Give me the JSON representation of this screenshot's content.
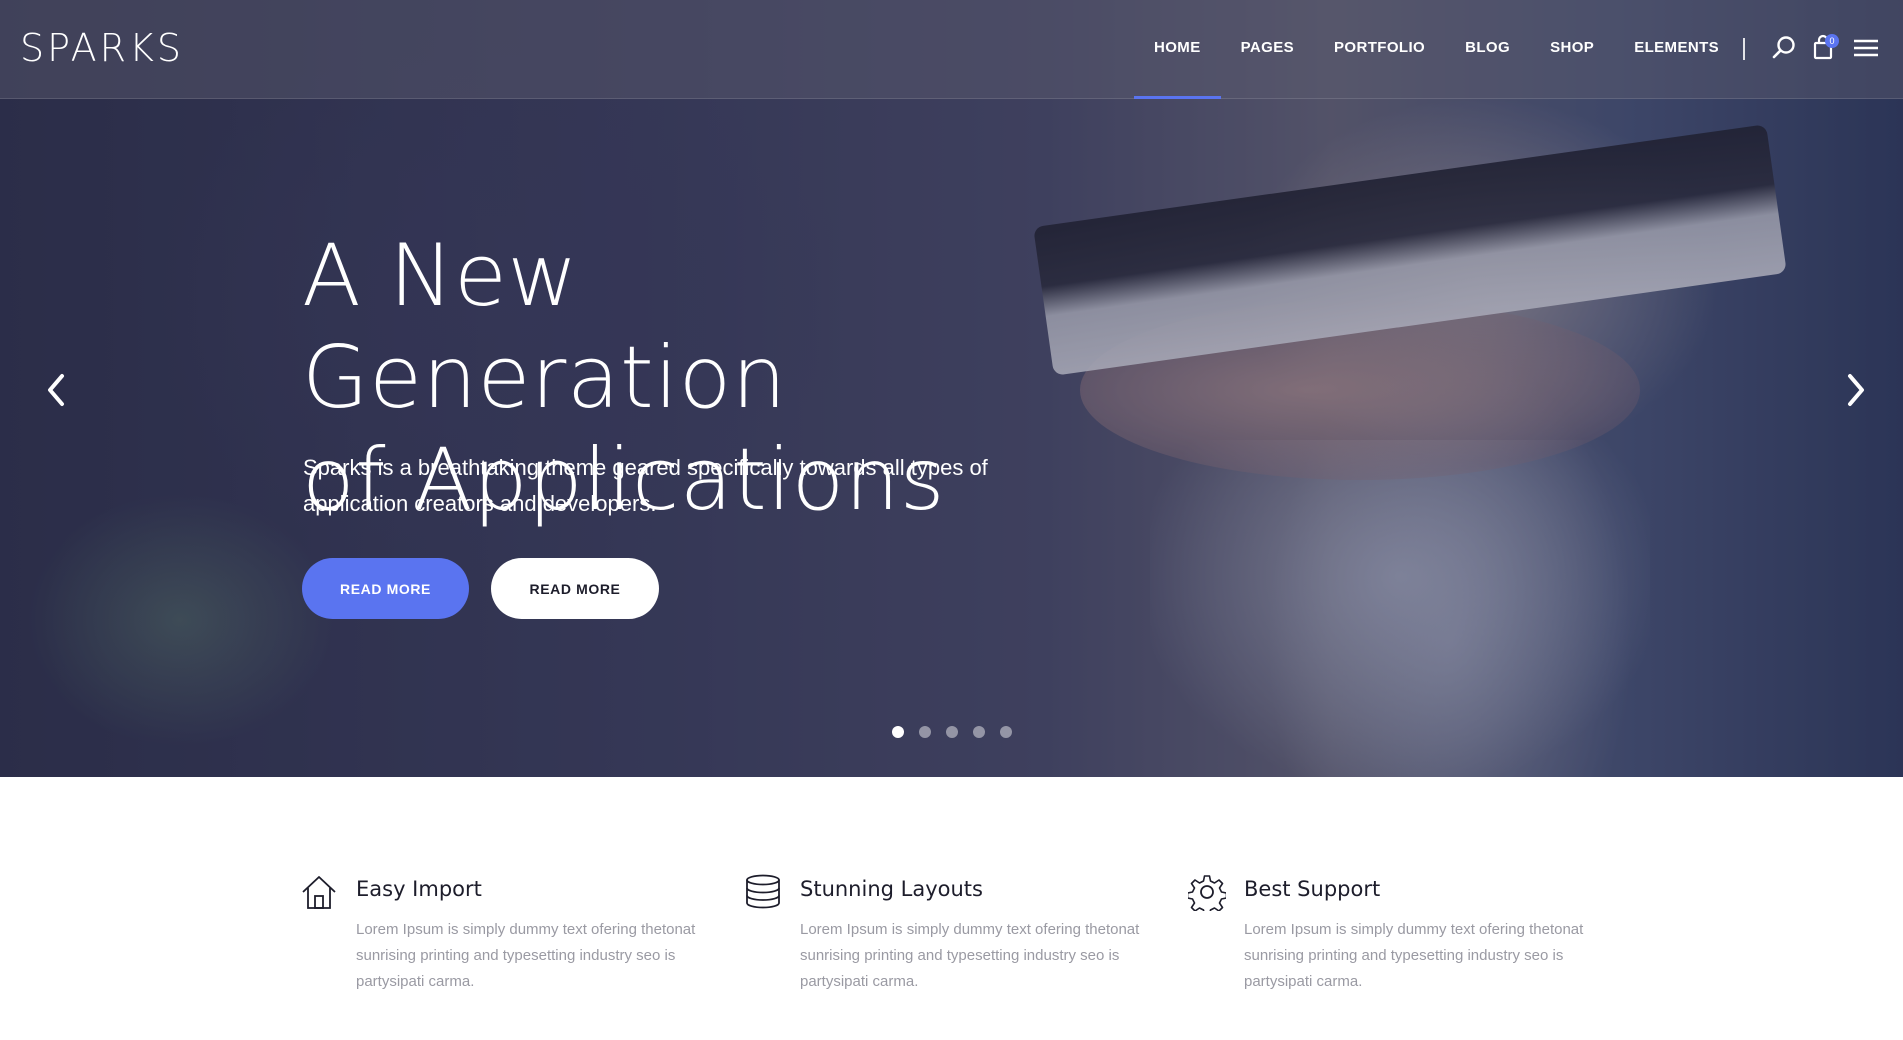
{
  "brand": {
    "logo": "SPARKS",
    "accent": "#5a74f0"
  },
  "nav": {
    "items": [
      {
        "label": "HOME",
        "active": true
      },
      {
        "label": "PAGES",
        "active": false
      },
      {
        "label": "PORTFOLIO",
        "active": false
      },
      {
        "label": "BLOG",
        "active": false
      },
      {
        "label": "SHOP",
        "active": false
      },
      {
        "label": "ELEMENTS",
        "active": false
      }
    ],
    "icons": [
      "search-icon",
      "cart-icon",
      "menu-icon"
    ],
    "cart_count": "0"
  },
  "hero": {
    "title_line1": "A New Generation",
    "title_line2": "of Applications",
    "subtitle_line1": "Sparks is a breathtaking theme geared specifically towards all types of",
    "subtitle_line2": "application creators and developers.",
    "primary_button": "READ MORE",
    "secondary_button": "READ MORE",
    "slides_total": 5,
    "active_slide": 1
  },
  "features": [
    {
      "icon": "home-icon",
      "title": "Easy Import",
      "text": "Lorem Ipsum is simply dummy text ofering thetonat sunrising printing and typesetting industry seo is partysipati carma."
    },
    {
      "icon": "database-icon",
      "title": "Stunning Layouts",
      "text": "Lorem Ipsum is simply dummy text ofering thetonat sunrising printing and typesetting industry seo is partysipati carma."
    },
    {
      "icon": "gear-icon",
      "title": "Best Support",
      "text": "Lorem Ipsum is simply dummy text ofering thetonat sunrising printing and typesetting industry seo is partysipati carma."
    }
  ]
}
